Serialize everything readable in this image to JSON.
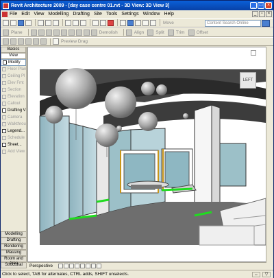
{
  "window": {
    "title": "Revit Architecture 2009 - [day case centre 01.rvt - 3D View: 3D View 3]"
  },
  "menu": [
    "File",
    "Edit",
    "View",
    "Modelling",
    "Drafting",
    "Site",
    "Tools",
    "Settings",
    "Window",
    "Help"
  ],
  "toolbar": {
    "move_label": "Move",
    "search_placeholder": "Content Search Online",
    "row2": [
      "Plane",
      "Demolish",
      "Align",
      "Split",
      "Trim",
      "Offset"
    ],
    "row3": [
      "Pick Line",
      "Pick Wall",
      "Preview Drag"
    ]
  },
  "left_panel": {
    "top_tabs": [
      "Basics",
      "View"
    ],
    "tools": [
      {
        "label": "Modify",
        "state": "selected"
      },
      {
        "label": "Floor Plan",
        "state": "disabled"
      },
      {
        "label": "Ceiling Pl",
        "state": "disabled"
      },
      {
        "label": "Elev Fmt",
        "state": "disabled"
      },
      {
        "label": "Section",
        "state": "disabled"
      },
      {
        "label": "Elevation",
        "state": "disabled"
      },
      {
        "label": "Callout",
        "state": "disabled"
      },
      {
        "label": "Drafting V",
        "state": "enabled"
      },
      {
        "label": "Camera",
        "state": "disabled"
      },
      {
        "label": "Walkthrou",
        "state": "disabled"
      },
      {
        "label": "Legend...",
        "state": "enabled"
      },
      {
        "label": "Schedule",
        "state": "disabled"
      },
      {
        "label": "Sheet...",
        "state": "enabled"
      },
      {
        "label": "Add View",
        "state": "disabled"
      }
    ],
    "bottom_tabs": [
      "Modelling",
      "Drafting",
      "Rendering",
      "Massing",
      "Room and Area",
      "Structural"
    ]
  },
  "view": {
    "viewcube_label": "LEFT",
    "view_control_label": "Perspective"
  },
  "status": {
    "message": "Click to select, TAB for alternates, CTRL adds, SHIFT unselects."
  },
  "colors": {
    "titlebar": "#0a4fc8",
    "highlight_green": "#1fdc1f",
    "floor": "#6e6e6e"
  }
}
